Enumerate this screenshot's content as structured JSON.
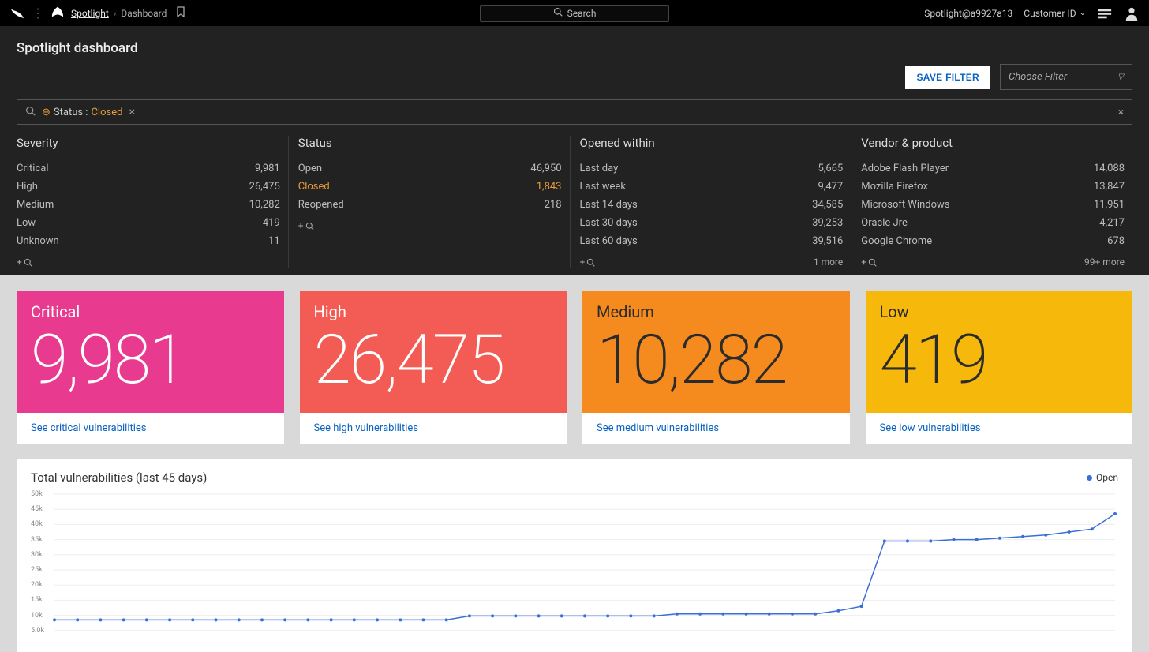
{
  "header": {
    "app_link": "Spotlight",
    "crumb_current": "Dashboard",
    "search_placeholder": "Search",
    "tenant": "Spotlight@a9927a13",
    "customer_label": "Customer ID"
  },
  "page": {
    "title": "Spotlight dashboard",
    "save_filter": "SAVE FILTER",
    "choose_filter_placeholder": "Choose Filter"
  },
  "filter_chip": {
    "field": "Status",
    "value": "Closed"
  },
  "facets": {
    "severity": {
      "title": "Severity",
      "items": [
        {
          "label": "Critical",
          "count": "9,981"
        },
        {
          "label": "High",
          "count": "26,475"
        },
        {
          "label": "Medium",
          "count": "10,282"
        },
        {
          "label": "Low",
          "count": "419"
        },
        {
          "label": "Unknown",
          "count": "11"
        }
      ]
    },
    "status": {
      "title": "Status",
      "items": [
        {
          "label": "Open",
          "count": "46,950"
        },
        {
          "label": "Closed",
          "count": "1,843",
          "active": true
        },
        {
          "label": "Reopened",
          "count": "218"
        }
      ]
    },
    "opened": {
      "title": "Opened within",
      "items": [
        {
          "label": "Last day",
          "count": "5,665"
        },
        {
          "label": "Last week",
          "count": "9,477"
        },
        {
          "label": "Last 14 days",
          "count": "34,585"
        },
        {
          "label": "Last 30 days",
          "count": "39,253"
        },
        {
          "label": "Last 60 days",
          "count": "39,516"
        }
      ],
      "more": "1 more"
    },
    "vendor": {
      "title": "Vendor & product",
      "items": [
        {
          "label": "Adobe Flash Player",
          "count": "14,088"
        },
        {
          "label": "Mozilla Firefox",
          "count": "13,847"
        },
        {
          "label": "Microsoft Windows",
          "count": "11,951"
        },
        {
          "label": "Oracle Jre",
          "count": "4,217"
        },
        {
          "label": "Google Chrome",
          "count": "678"
        }
      ],
      "more": "99+ more"
    }
  },
  "tiles": {
    "critical": {
      "label": "Critical",
      "value": "9,981",
      "link": "See critical vulnerabilities"
    },
    "high": {
      "label": "High",
      "value": "26,475",
      "link": "See high vulnerabilities"
    },
    "medium": {
      "label": "Medium",
      "value": "10,282",
      "link": "See medium vulnerabilities"
    },
    "low": {
      "label": "Low",
      "value": "419",
      "link": "See low vulnerabilities"
    }
  },
  "chart": {
    "title": "Total vulnerabilities (last 45 days)",
    "legend": "Open"
  },
  "chart_data": {
    "type": "line",
    "title": "Total vulnerabilities (last 45 days)",
    "xlabel": "",
    "ylabel": "",
    "ylim": [
      0,
      50000
    ],
    "yticks": [
      "5.0k",
      "10k",
      "15k",
      "20k",
      "25k",
      "30k",
      "35k",
      "40k",
      "45k",
      "50k"
    ],
    "series": [
      {
        "name": "Open",
        "values": [
          8500,
          8500,
          8500,
          8500,
          8500,
          8500,
          8500,
          8500,
          8500,
          8500,
          8500,
          8500,
          8500,
          8500,
          8500,
          8500,
          8500,
          8500,
          9800,
          9800,
          9800,
          9800,
          9800,
          9800,
          9800,
          9800,
          9800,
          10500,
          10500,
          10500,
          10500,
          10500,
          10500,
          10500,
          11500,
          13000,
          34500,
          34500,
          34500,
          35000,
          35000,
          35500,
          36000,
          36500,
          37500,
          38500,
          43500
        ]
      }
    ]
  }
}
